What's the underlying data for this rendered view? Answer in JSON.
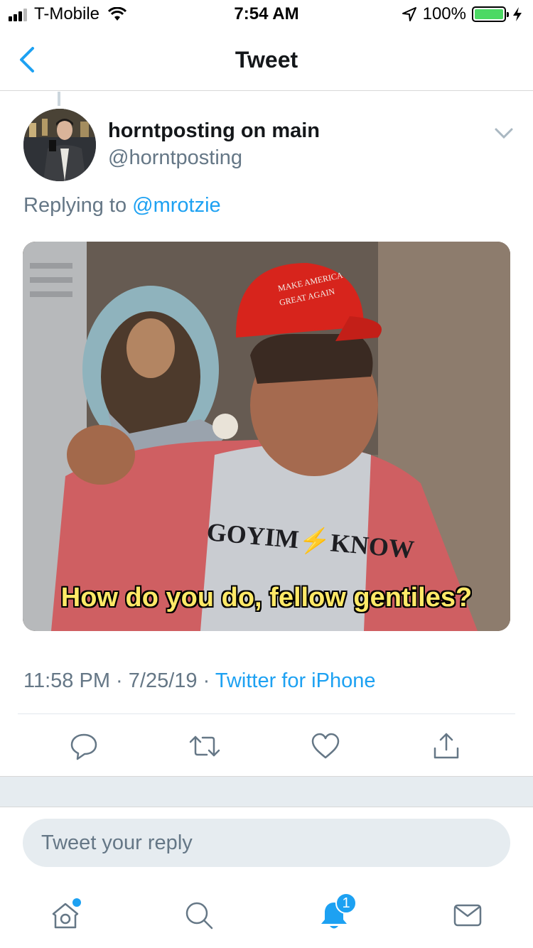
{
  "status_bar": {
    "carrier": "T-Mobile",
    "time": "7:54 AM",
    "battery": "100%",
    "battery_level": 1.0
  },
  "nav": {
    "title": "Tweet",
    "back_icon": "chevron-left-icon"
  },
  "tweet": {
    "author_name": "horntposting on main",
    "author_handle": "@horntposting",
    "replying_prefix": "Replying to",
    "replying_to": "@mrotzie",
    "media": {
      "caption": "How do you do, fellow gentiles?",
      "hat_text_line1": "MAKE AMERICA",
      "hat_text_line2": "GREAT AGAIN",
      "shirt_text": "GOYIM⚡KNOW"
    },
    "time": "11:58 PM",
    "separator": "·",
    "date": "7/25/19",
    "source": "Twitter for iPhone"
  },
  "actions": [
    {
      "icon": "reply-icon"
    },
    {
      "icon": "retweet-icon"
    },
    {
      "icon": "like-icon"
    },
    {
      "icon": "share-icon"
    }
  ],
  "reply_box": {
    "placeholder": "Tweet your reply"
  },
  "tab_bar": {
    "notifications_badge": "1",
    "items": [
      "home-icon",
      "search-icon",
      "notifications-icon",
      "messages-icon"
    ]
  },
  "colors": {
    "accent": "#1da1f2",
    "secondary_text": "#657786",
    "battery": "#4cd964",
    "caption": "#ffe967",
    "hat": "#d7241c"
  }
}
